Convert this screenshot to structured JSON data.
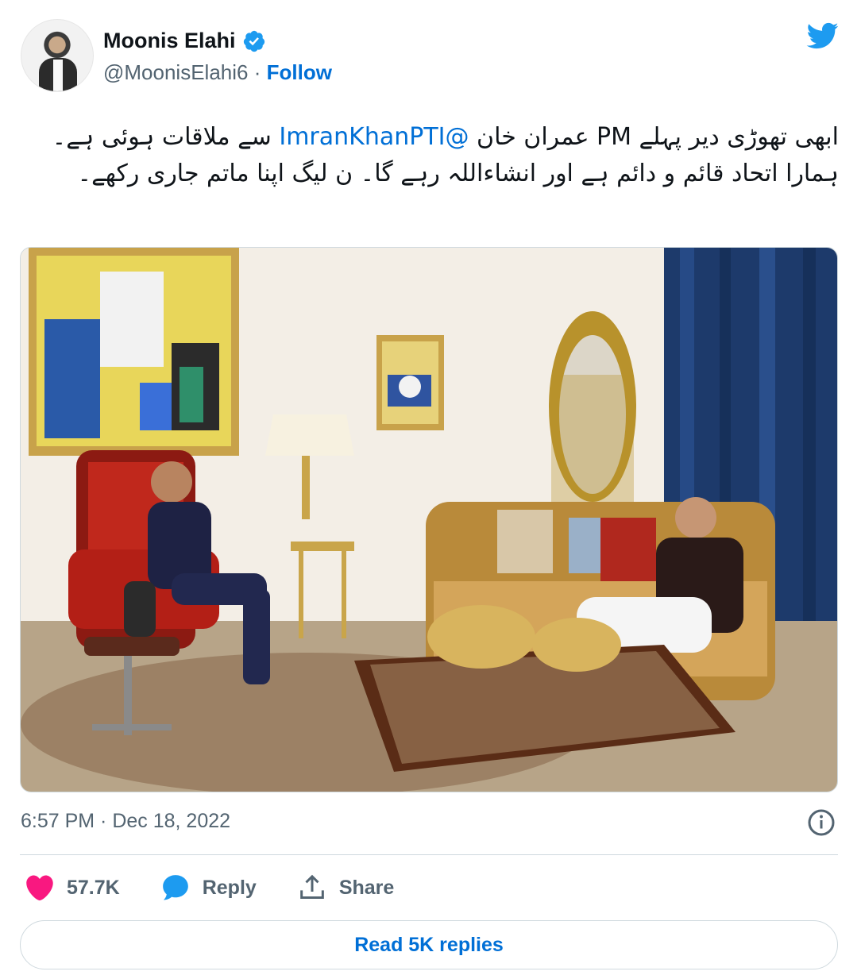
{
  "author": {
    "name": "Moonis Elahi",
    "handle": "@MoonisElahi6",
    "separator": "·",
    "follow_label": "Follow"
  },
  "tweet": {
    "text_before_mention": "ابھی تھوڑی دیر پہلے PM عمران خان",
    "mention": "@ImranKhanPTI",
    "text_after_mention": "سے ملاقات ہوئی ہے۔ ہمارا اتحاد قائم و دائم ہے اور انشاءاللہ رہے گا۔ ن لیگ اپنا ماتم جاری رکھے۔",
    "timestamp": "6:57 PM · Dec 18, 2022"
  },
  "actions": {
    "likes_count": "57.7K",
    "reply_label": "Reply",
    "share_label": "Share"
  },
  "read_replies_label": "Read 5K replies",
  "colors": {
    "link": "#006fd6",
    "muted": "#536471",
    "like": "#f91880",
    "reply": "#1d9bf0",
    "border": "#cfd9de"
  },
  "icons": [
    "verified-badge-icon",
    "twitter-bird-icon",
    "info-icon",
    "heart-icon",
    "reply-bubble-icon",
    "share-icon"
  ]
}
